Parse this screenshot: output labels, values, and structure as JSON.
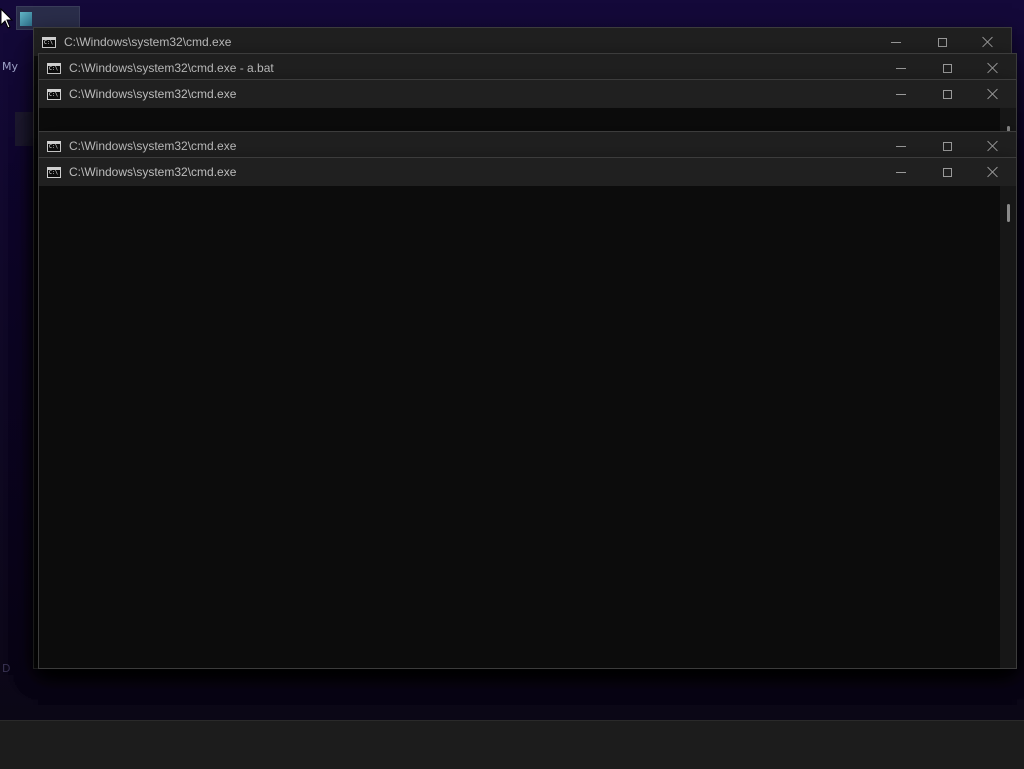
{
  "desktop": {
    "label": "My",
    "corner_char": "D"
  },
  "windows": [
    {
      "title": "C:\\Windows\\system32\\cmd.exe"
    },
    {
      "title": "C:\\Windows\\system32\\cmd.exe - a.bat"
    },
    {
      "title": "C:\\Windows\\system32\\cmd.exe"
    },
    {
      "title": "C:\\Windows\\system32\\cmd.exe"
    },
    {
      "title": "C:\\Windows\\system32\\cmd.exe"
    }
  ],
  "icons": {
    "app": "cmd-icon",
    "minimize": "minimize-icon",
    "maximize": "maximize-icon",
    "close": "close-icon"
  },
  "colors": {
    "titlebar": "#202020",
    "console": "#0c0c0c",
    "title_text": "#bdbdbd",
    "desktop": "#14093a",
    "taskbar": "#1c1c1c"
  }
}
